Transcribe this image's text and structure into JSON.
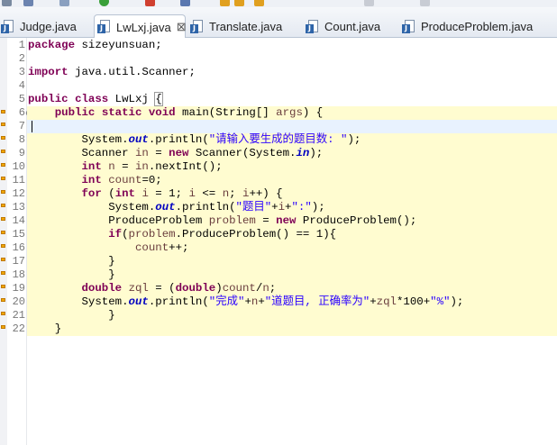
{
  "toolbar": {
    "icons": [
      "toolbar-icon",
      "toolbar-icon",
      "run-icon",
      "toolbar-icon",
      "toolbar-icon",
      "toolbar-icon",
      "back-icon",
      "forward-icon"
    ]
  },
  "tabs": [
    {
      "label": "Judge.java",
      "active": false
    },
    {
      "label": "LwLxj.java",
      "active": true,
      "close": "⊠"
    },
    {
      "label": "Translate.java",
      "active": false
    },
    {
      "label": "Count.java",
      "active": false
    },
    {
      "label": "ProduceProblem.java",
      "active": false
    }
  ],
  "editor": {
    "lines": [
      {
        "n": "1",
        "text": "package sizeyunsuan;"
      },
      {
        "n": "2",
        "text": ""
      },
      {
        "n": "3",
        "text": "import java.util.Scanner;"
      },
      {
        "n": "4",
        "text": ""
      },
      {
        "n": "5",
        "text": "public class LwLxj {"
      },
      {
        "n": "6",
        "text": "    public static void main(String[] args) {"
      },
      {
        "n": "7",
        "text": ""
      },
      {
        "n": "8",
        "text": "        System.out.println(\"请输入要生成的题目数: \");"
      },
      {
        "n": "9",
        "text": "        Scanner in = new Scanner(System.in);"
      },
      {
        "n": "10",
        "text": "        int n = in.nextInt();"
      },
      {
        "n": "11",
        "text": "        int count=0;"
      },
      {
        "n": "12",
        "text": "        for (int i = 1; i <= n; i++) {"
      },
      {
        "n": "13",
        "text": "            System.out.println(\"题目\"+i+\":\");"
      },
      {
        "n": "14",
        "text": "            ProduceProblem problem = new ProduceProblem();"
      },
      {
        "n": "15",
        "text": "            if(problem.ProduceProblem() == 1){"
      },
      {
        "n": "16",
        "text": "                count++;"
      },
      {
        "n": "17",
        "text": "            }"
      },
      {
        "n": "18",
        "text": "            }"
      },
      {
        "n": "19",
        "text": "        double zql = (double)count/n;"
      },
      {
        "n": "20",
        "text": "        System.out.println(\"完成\"+n+\"道题目, 正确率为\"+zql*100+\"%\");"
      },
      {
        "n": "21",
        "text": "            }"
      },
      {
        "n": "22",
        "text": "    }"
      }
    ]
  },
  "colors": {
    "keyword": "#7f0055",
    "string": "#2a00ff",
    "static_field": "#0000c0",
    "local_var": "#6a3e3e",
    "highlight": "#fffcd0",
    "line_number": "#787878"
  }
}
